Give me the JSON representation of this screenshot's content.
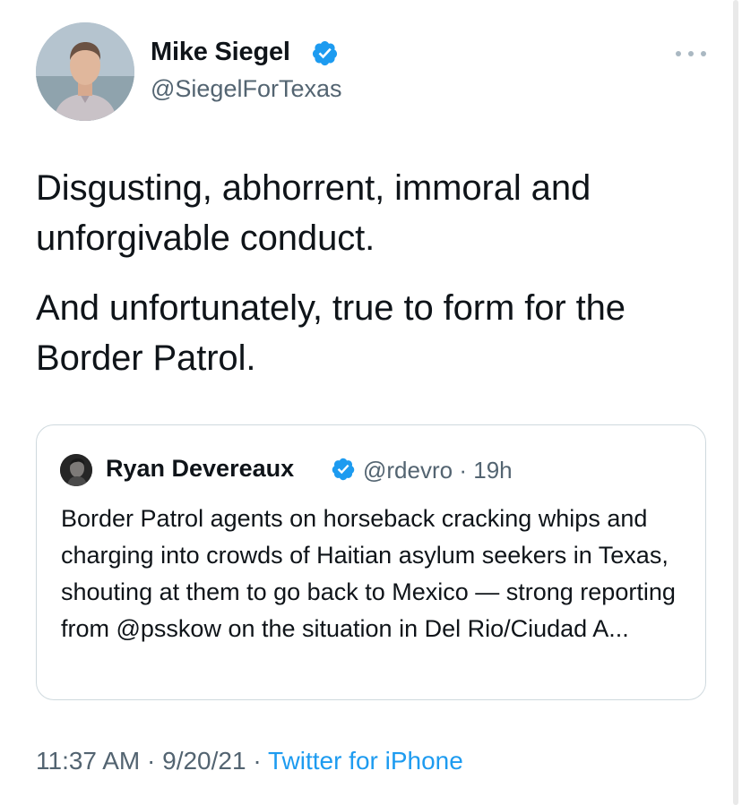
{
  "author": {
    "name": "Mike Siegel",
    "handle": "@SiegelForTexas",
    "verified": true
  },
  "tweet": {
    "paragraphs": [
      "Disgusting, abhorrent, immoral and unforgivable conduct.",
      "And unfortunately, true to form for the Border Patrol."
    ]
  },
  "quoted_tweet": {
    "name": "Ryan Devereaux",
    "handle": "@rdevro",
    "separator": "·",
    "age": "19h",
    "verified": true,
    "text": "Border Patrol agents on horseback cracking whips and charging into crowds of Haitian asylum seekers in Texas, shouting at them to go back to Mexico — strong reporting from @psskow on the situation in Del Rio/Ciudad A..."
  },
  "footer": {
    "time": "11:37 AM",
    "separator": "·",
    "date": "9/20/21",
    "source": "Twitter for iPhone"
  },
  "icons": {
    "verified": "verified-badge-icon",
    "more": "more-horizontal-icon"
  },
  "colors": {
    "accent": "#1d9bf0",
    "secondary_text": "#536471",
    "border": "#cfd9de"
  }
}
